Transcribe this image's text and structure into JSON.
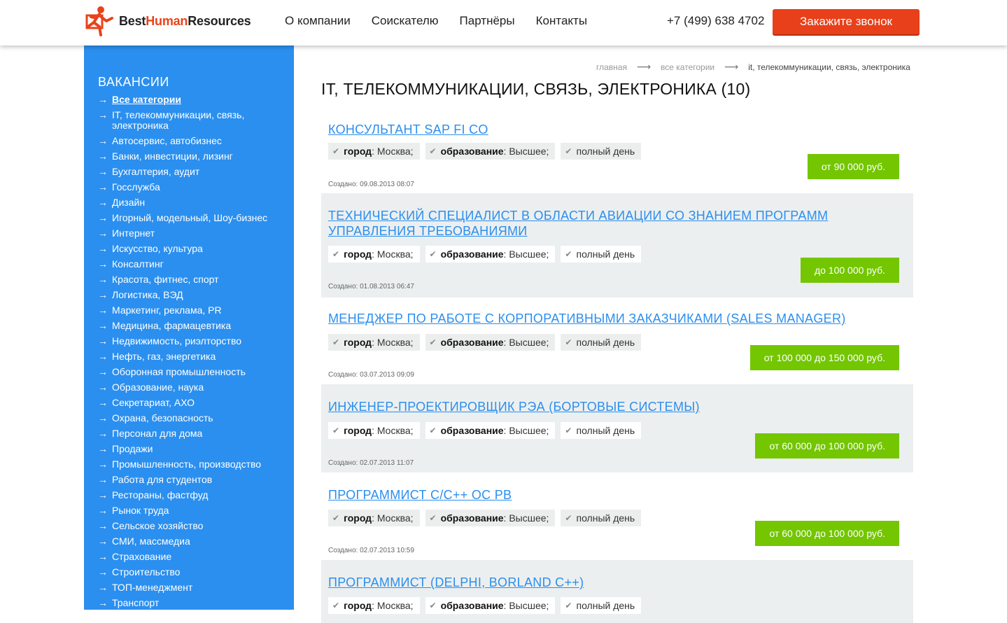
{
  "header": {
    "logo": {
      "part1": "Best",
      "part2": "Human",
      "part3": "Resources"
    },
    "nav": [
      "О компании",
      "Соискателю",
      "Партнёры",
      "Контакты"
    ],
    "phone": "+7 (499) 638 4702",
    "call_button": "Закажите звонок",
    "colors": {
      "accent": "#e8401a",
      "sidebar": "#2b8fef",
      "salary": "#73c600"
    }
  },
  "sidebar": {
    "title": "ВАКАНСИИ",
    "arrow": "→",
    "items": [
      "Все категории",
      "IT, телекоммуникации, связь, электроника",
      "Автосервис, автобизнес",
      "Банки, инвестиции, лизинг",
      "Бухгалтерия, аудит",
      "Госслужба",
      "Дизайн",
      "Игорный, модельный, Шоу-бизнес",
      "Интернет",
      "Искусство, культура",
      "Консалтинг",
      "Красота, фитнес, спорт",
      "Логистика, ВЭД",
      "Маркетинг, реклама, PR",
      "Медицина, фармацевтика",
      "Недвижимость, риэлторство",
      "Нефть, газ, энергетика",
      "Оборонная промышленность",
      "Образование, наука",
      "Секретариат, АХО",
      "Охрана, безопасность",
      "Персонал для дома",
      "Продажи",
      "Промышленность, производство",
      "Работа для студентов",
      "Рестораны, фастфуд",
      "Рынок труда",
      "Сельское хозяйство",
      "СМИ, массмедиа",
      "Страхование",
      "Строительство",
      "ТОП-менеджмент",
      "Транспорт"
    ]
  },
  "breadcrumb": {
    "home": "главная",
    "categories": "все категории",
    "current": "it, телекоммуникации, связь, электроника",
    "sep": "⟶"
  },
  "page_title": "IT, ТЕЛЕКОММУНИКАЦИИ, СВЯЗЬ, ЭЛЕКТРОНИКА (10)",
  "tag_labels": {
    "city": "город",
    "education": "образование",
    "schedule": "полный день"
  },
  "jobs": [
    {
      "title": "КОНСУЛЬТАНТ SAP FI CO",
      "city": "Москва;",
      "education": "Высшее;",
      "salary": "от 90 000 руб.",
      "created": "Создано: 09.08.2013 08:07"
    },
    {
      "title": "ТЕХНИЧЕСКИЙ СПЕЦИАЛИСТ В ОБЛАСТИ АВИАЦИИ СО ЗНАНИЕМ ПРОГРАММ УПРАВЛЕНИЯ ТРЕБОВАНИЯМИ",
      "city": "Москва;",
      "education": "Высшее;",
      "salary": "до 100 000 руб.",
      "created": "Создано: 01.08.2013 06:47"
    },
    {
      "title": "МЕНЕДЖЕР ПО РАБОТЕ С КОРПОРАТИВНЫМИ ЗАКАЗЧИКАМИ (SALES MANAGER)",
      "city": "Москва;",
      "education": "Высшее;",
      "salary": "от 100 000 до 150 000 руб.",
      "created": "Создано: 03.07.2013 09:09"
    },
    {
      "title": "ИНЖЕНЕР-ПРОЕКТИРОВЩИК РЭА (БОРТОВЫЕ СИСТЕМЫ)",
      "city": "Москва;",
      "education": "Высшее;",
      "salary": "от 60 000 до 100 000 руб.",
      "created": "Создано: 02.07.2013 11:07"
    },
    {
      "title": "ПРОГРАММИСТ С/С++ ОС РВ",
      "city": "Москва;",
      "education": "Высшее;",
      "salary": "от 60 000 до 100 000 руб.",
      "created": "Создано: 02.07.2013 10:59"
    },
    {
      "title": "ПРОГРАММИСТ (DELPHI, BORLAND C++)",
      "city": "Москва;",
      "education": "Высшее;",
      "salary": "",
      "created": ""
    }
  ]
}
